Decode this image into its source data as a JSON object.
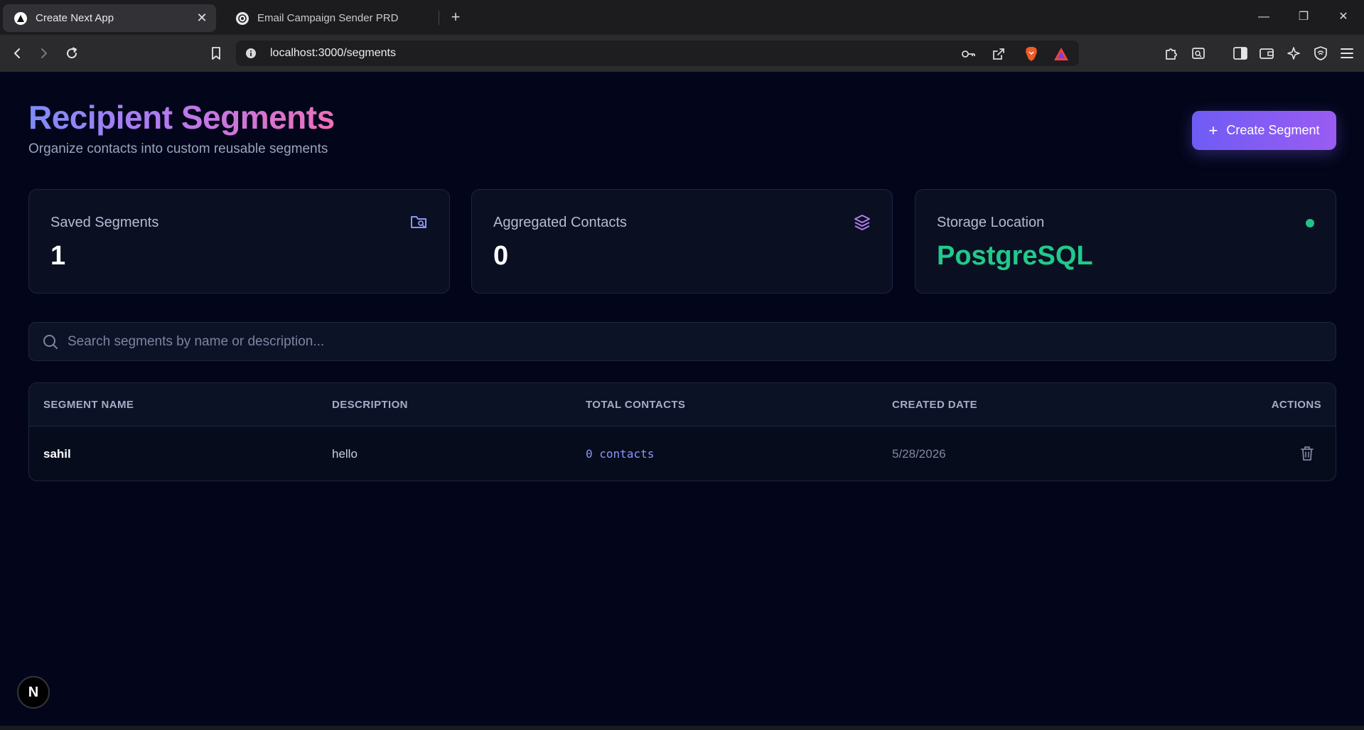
{
  "browser": {
    "tabs": [
      {
        "title": "Create Next App",
        "active": true
      },
      {
        "title": "Email Campaign Sender PRD",
        "active": false
      }
    ],
    "url": "localhost:3000/segments",
    "icons": [
      "back-icon",
      "forward-icon",
      "reload-icon",
      "bookmark-icon",
      "key-icon",
      "share-icon",
      "brave-shield-icon",
      "rewards-icon",
      "extensions-icon",
      "reading-list-icon",
      "sidebar-icon",
      "wallet-icon",
      "leo-ai-icon",
      "vpn-icon",
      "menu-icon"
    ]
  },
  "header": {
    "title": "Recipient Segments",
    "subtitle": "Organize contacts into custom reusable segments",
    "create_label": "Create Segment"
  },
  "stats": [
    {
      "label": "Saved Segments",
      "value": "1",
      "icon": "folder-search-icon"
    },
    {
      "label": "Aggregated Contacts",
      "value": "0",
      "icon": "layers-icon"
    },
    {
      "label": "Storage Location",
      "value": "PostgreSQL",
      "icon": "status-dot"
    }
  ],
  "search": {
    "placeholder": "Search segments by name or description..."
  },
  "table": {
    "headers": [
      "SEGMENT NAME",
      "DESCRIPTION",
      "TOTAL CONTACTS",
      "CREATED DATE",
      "ACTIONS"
    ],
    "rows": [
      {
        "name": "sahil",
        "description": "hello",
        "contacts": "0 contacts",
        "created": "5/28/2026"
      }
    ]
  },
  "dev_badge": "N",
  "colors": {
    "background": "#03061a",
    "accent": "#7c5cf5",
    "success": "#22c98a",
    "link": "#8b96f6"
  }
}
